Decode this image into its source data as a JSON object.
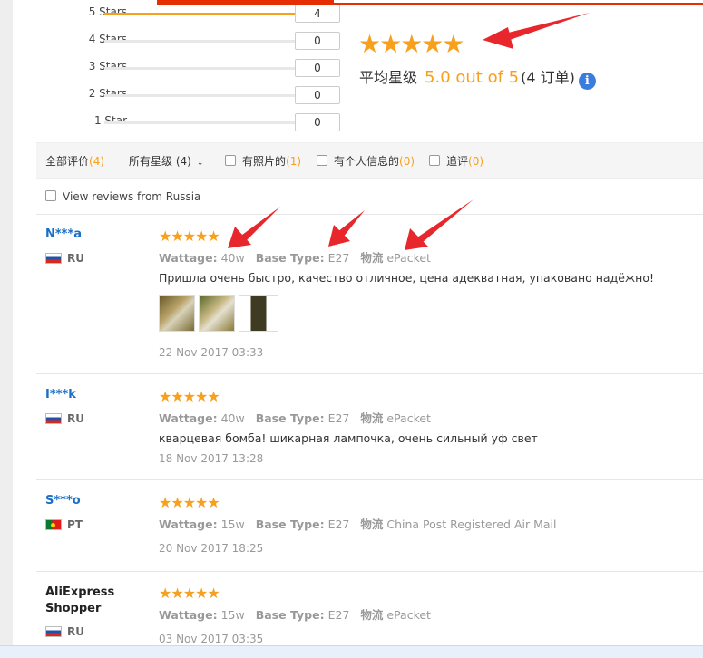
{
  "histogram": [
    {
      "label": "5 Stars",
      "count": "4",
      "fraction": 1.0
    },
    {
      "label": "4 Stars",
      "count": "0",
      "fraction": 0
    },
    {
      "label": "3 Stars",
      "count": "0",
      "fraction": 0
    },
    {
      "label": "2 Stars",
      "count": "0",
      "fraction": 0
    },
    {
      "label": "1 Star",
      "count": "0",
      "fraction": 0
    }
  ],
  "summary": {
    "stars": "★★★★★",
    "avg_label": "平均星级",
    "avg_value": "5.0 out of 5",
    "orders": "(4 订单)",
    "info_icon": "i"
  },
  "filters": {
    "all_label": "全部评价",
    "all_count": "(4)",
    "rating_label": "所有星级",
    "rating_count": "(4)",
    "caret": "⌄",
    "photos_label": "有照片的",
    "photos_count": "(1)",
    "personal_label": "有个人信息的",
    "personal_count": "(0)",
    "followup_label": "追评",
    "followup_count": "(0)"
  },
  "russia_filter": "View reviews from Russia",
  "attr_keys": {
    "wattage": "Wattage:",
    "base": "Base Type:",
    "logistics": "物流"
  },
  "reviews": [
    {
      "user": "N***a",
      "country": "RU",
      "stars": "★★★★★",
      "wattage": "40w",
      "base": "E27",
      "logistics": "ePacket",
      "text": "Пришла очень быстро, качество отличное, цена адекватная, упаковано надёжно!",
      "date": "22 Nov 2017 03:33"
    },
    {
      "user": "I***k",
      "country": "RU",
      "stars": "★★★★★",
      "wattage": "40w",
      "base": "E27",
      "logistics": "ePacket",
      "text": "кварцевая бомба! шикарная лампочка, очень сильный уф свет",
      "date": "18 Nov 2017 13:28"
    },
    {
      "user": "S***o",
      "country": "PT",
      "stars": "★★★★★",
      "wattage": "15w",
      "base": "E27",
      "logistics": "China Post Registered Air Mail",
      "text": "",
      "date": "20 Nov 2017 18:25"
    },
    {
      "user": "AliExpress Shopper",
      "country": "RU",
      "stars": "★★★★★",
      "wattage": "15w",
      "base": "E27",
      "logistics": "ePacket",
      "text": "",
      "date": "03 Nov 2017 03:35"
    }
  ],
  "colors": {
    "accent": "#f7a01d",
    "link": "#1a6fc4",
    "brand_red": "#e62e04",
    "arrow": "#e8272c"
  }
}
